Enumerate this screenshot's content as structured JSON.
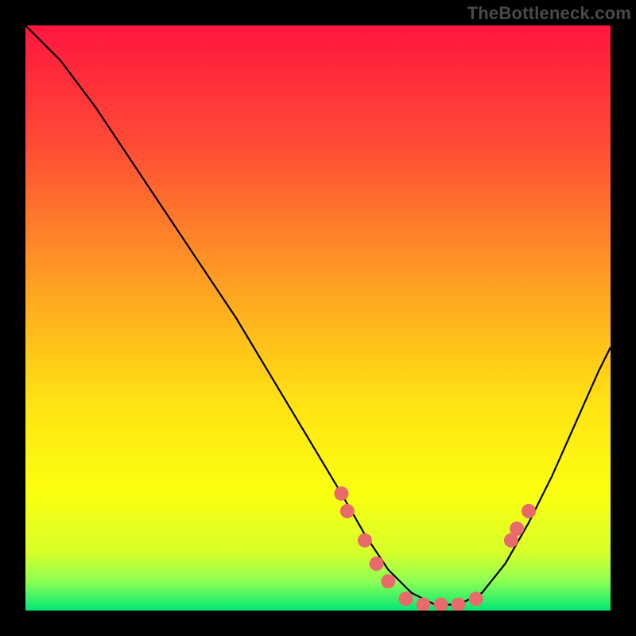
{
  "watermark": "TheBottleneck.com",
  "chart_data": {
    "type": "line",
    "title": "",
    "xlabel": "",
    "ylabel": "",
    "xlim": [
      0,
      100
    ],
    "ylim": [
      0,
      100
    ],
    "gradient_stops": [
      {
        "offset": 0,
        "color": "#ff163e"
      },
      {
        "offset": 0.2,
        "color": "#ff4a36"
      },
      {
        "offset": 0.45,
        "color": "#ffa321"
      },
      {
        "offset": 0.65,
        "color": "#ffe413"
      },
      {
        "offset": 0.8,
        "color": "#fbff10"
      },
      {
        "offset": 0.9,
        "color": "#d8ff2a"
      },
      {
        "offset": 0.95,
        "color": "#8dff54"
      },
      {
        "offset": 1.0,
        "color": "#00e874"
      }
    ],
    "curve": {
      "x": [
        0,
        6,
        12,
        18,
        24,
        30,
        36,
        42,
        48,
        54,
        58,
        62,
        66,
        70,
        74,
        78,
        82,
        86,
        90,
        94,
        98,
        100
      ],
      "y": [
        100,
        94,
        86,
        77,
        68,
        59,
        50,
        40,
        30,
        20,
        13,
        7,
        3,
        1,
        1,
        3,
        8,
        15,
        23,
        32,
        41,
        45
      ]
    },
    "markers": {
      "color": "#e86a6a",
      "radius": 9,
      "points": [
        {
          "x": 54,
          "y": 20
        },
        {
          "x": 55,
          "y": 17
        },
        {
          "x": 58,
          "y": 12
        },
        {
          "x": 60,
          "y": 8
        },
        {
          "x": 62,
          "y": 5
        },
        {
          "x": 65,
          "y": 2
        },
        {
          "x": 68,
          "y": 1
        },
        {
          "x": 71,
          "y": 1
        },
        {
          "x": 74,
          "y": 1
        },
        {
          "x": 77,
          "y": 2
        },
        {
          "x": 83,
          "y": 12
        },
        {
          "x": 84,
          "y": 14
        },
        {
          "x": 86,
          "y": 17
        }
      ]
    }
  }
}
